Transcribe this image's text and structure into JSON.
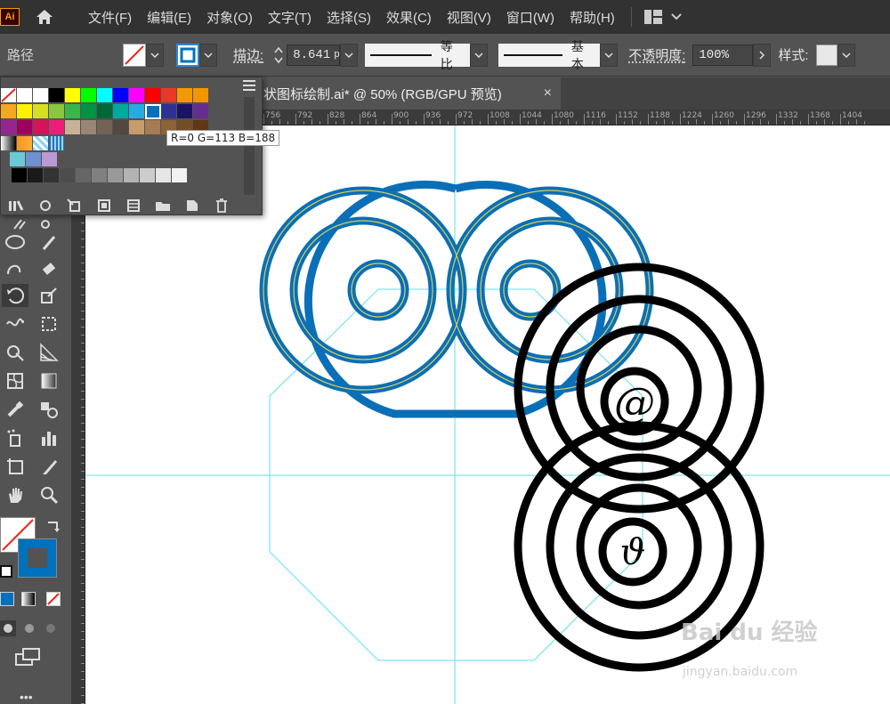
{
  "app": {
    "logo_text": "Ai"
  },
  "menu": [
    "文件(F)",
    "编辑(E)",
    "对象(O)",
    "文字(T)",
    "选择(S)",
    "效果(C)",
    "视图(V)",
    "窗口(W)",
    "帮助(H)"
  ],
  "control_bar": {
    "selection_type": "路径",
    "stroke_label": "描边",
    "stroke_weight": "8.641",
    "stroke_unit": "p",
    "profile_uniform": "等比",
    "brush_basic": "基本",
    "opacity_label": "不透明度",
    "opacity_value": "100%",
    "style_label": "样式",
    "colon": ":"
  },
  "document_tab": {
    "title": "状图标绘制.ai* @ 50% (RGB/GPU 预览)",
    "close": "×"
  },
  "ruler_h": [
    "756",
    "792",
    "828",
    "864",
    "900",
    "936",
    "972",
    "1008",
    "1044",
    "1080",
    "1116",
    "1152",
    "1188",
    "1224",
    "1260",
    "1296",
    "1332",
    "1368",
    "1404"
  ],
  "swatches": {
    "tooltip": "R=0 G=113 B=188",
    "row1": [
      "none",
      "#ffffff",
      "#ffffff",
      "#000000",
      "#ffff00",
      "#00ff00",
      "#00ffff",
      "#0000ff",
      "#ff00ff",
      "#ff0000",
      "#e83828",
      "#f39800",
      "#f29600"
    ],
    "row2": [
      "#f5a623",
      "#fff100",
      "#d7df23",
      "#8cc63f",
      "#39b54a",
      "#009245",
      "#006837",
      "#00a99d",
      "#29abe2",
      "#0071bc",
      "#2e3192",
      "#1b1464",
      "#662d91"
    ],
    "row3": [
      "#93278f",
      "#9e005d",
      "#d4145a",
      "#ed1e79",
      "#c7b299",
      "#998675",
      "#736357",
      "#534741",
      "#c69c6d",
      "#a67c52",
      "#8c6239",
      "#754c24",
      "#603813"
    ],
    "gray_row": [
      "#000000",
      "#1a1a1a",
      "#333333",
      "#4d4d4d",
      "#666666",
      "#808080",
      "#999999",
      "#b3b3b3",
      "#cccccc",
      "#e6e6e6",
      "#f2f2f2"
    ],
    "selected_color": "#0071bc"
  },
  "canvas": {
    "glyph_at": "@",
    "glyph_p": "ϑ"
  },
  "watermark": {
    "brand": "Bai du 经验",
    "url": "jingyan.baidu.com"
  }
}
